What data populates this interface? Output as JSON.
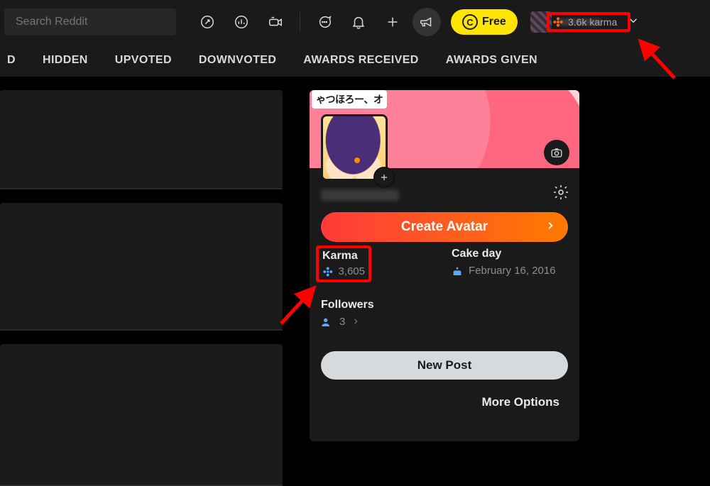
{
  "search": {
    "placeholder": "Search Reddit"
  },
  "topbar": {
    "free_label": "Free",
    "karma_chip": "3.6k karma"
  },
  "tabs": {
    "t0": "D",
    "t1": "HIDDEN",
    "t2": "UPVOTED",
    "t3": "DOWNVOTED",
    "t4": "AWARDS RECEIVED",
    "t5": "AWARDS GIVEN"
  },
  "profile": {
    "banner_text": "ゃつほろー、オ",
    "create_avatar": "Create Avatar",
    "karma_label": "Karma",
    "karma_value": "3,605",
    "cakeday_label": "Cake day",
    "cakeday_value": "February 16, 2016",
    "followers_label": "Followers",
    "followers_value": "3",
    "new_post": "New Post",
    "more_options": "More Options"
  },
  "colors": {
    "accent_orange": "#ff7a00",
    "accent_blue": "#5aa9ff",
    "annotation_red": "#ff0000"
  }
}
